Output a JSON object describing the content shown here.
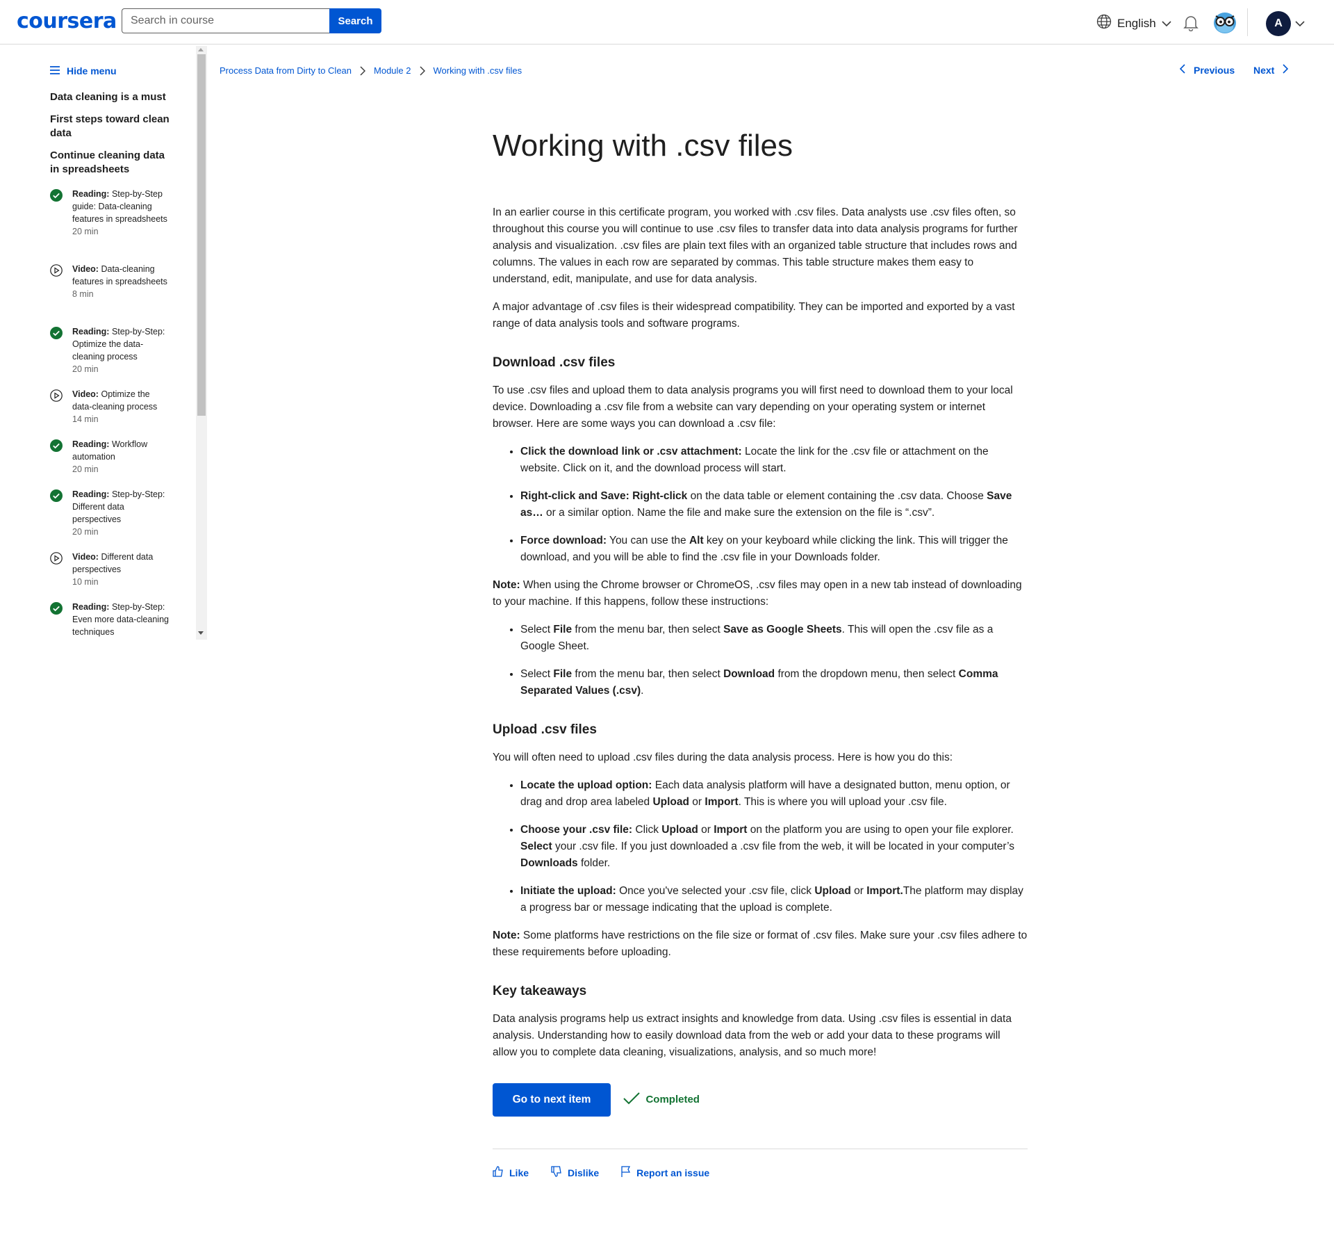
{
  "header": {
    "logo": "coursera",
    "search_placeholder": "Search in course",
    "search_button": "Search",
    "language": "English",
    "avatar_initial": "A"
  },
  "sidebar": {
    "hide_menu": "Hide menu",
    "sections": [
      "Data cleaning is a must",
      "First steps toward clean data",
      "Continue cleaning data in spreadsheets"
    ],
    "items": [
      {
        "type": "Reading:",
        "title": "Step-by-Step guide: Data-cleaning features in spreadsheets",
        "duration": "20 min",
        "status": "completed"
      },
      {
        "type": "Video:",
        "title": "Data-cleaning features in spreadsheets",
        "duration": "8 min",
        "status": "video"
      },
      {
        "type": "Reading:",
        "title": "Step-by-Step: Optimize the data-cleaning process",
        "duration": "20 min",
        "status": "completed"
      },
      {
        "type": "Video:",
        "title": "Optimize the data-cleaning process",
        "duration": "14 min",
        "status": "video"
      },
      {
        "type": "Reading:",
        "title": "Workflow automation",
        "duration": "20 min",
        "status": "completed"
      },
      {
        "type": "Reading:",
        "title": "Step-by-Step: Different data perspectives",
        "duration": "20 min",
        "status": "completed"
      },
      {
        "type": "Video:",
        "title": "Different data perspectives",
        "duration": "10 min",
        "status": "video"
      },
      {
        "type": "Reading:",
        "title": "Step-by-Step: Even more data-cleaning techniques",
        "duration": "",
        "status": "completed"
      }
    ]
  },
  "breadcrumb": [
    "Process Data from Dirty to Clean",
    "Module 2",
    "Working with .csv files"
  ],
  "nav": {
    "previous": "Previous",
    "next": "Next"
  },
  "article": {
    "title": "Working with .csv files",
    "intro_p1": "In an earlier course in this certificate program, you worked with .csv files. Data analysts use .csv files often, so throughout this course you will continue to use .csv files to transfer data into data analysis programs for further analysis and visualization. .csv files are plain text files with an organized table structure that includes rows and columns. The values in each row are separated by commas. This table structure makes them easy to understand, edit, manipulate, and use for data analysis.",
    "intro_p2": "A major advantage of .csv files is their widespread compatibility.  They can be imported and exported by a vast range of data analysis tools and software programs.",
    "download": {
      "heading": "Download .csv files",
      "intro": "To use .csv files and upload them to data analysis programs you will first need to download them to your local device. Downloading a .csv file from a website can vary depending on your operating system or internet browser. Here are some ways you can download a .csv file:",
      "b1_bold": "Click the download link or .csv attachment:",
      "b1_text": " Locate the link for the .csv file or attachment on the website. Click on it, and the download process will start.",
      "b2_bold1": "Right-click and Save: Right-click",
      "b2_text1": " on the data table or element containing the .csv data. Choose ",
      "b2_bold2": "Save as…",
      "b2_text2": " or a similar option. Name the file and make sure the extension on the file is “.csv”.",
      "b3_bold1": "Force download:",
      "b3_text1": " You can use the ",
      "b3_bold2": "Alt",
      "b3_text2": " key on your keyboard while clicking the link. This will trigger the download, and you will be able to find the .csv file in your Downloads folder.",
      "note_bold": "Note:",
      "note_text": " When using the Chrome browser or ChromeOS, .csv files may open in a new tab instead of downloading to your machine. If this happens, follow these instructions:",
      "s1_t1": "Select ",
      "s1_b1": "File",
      "s1_t2": " from the menu bar, then select ",
      "s1_b2": "Save as Google Sheets",
      "s1_t3": ". This will open the .csv file as a Google Sheet.",
      "s2_t1": "Select ",
      "s2_b1": "File",
      "s2_t2": " from the menu bar, then select ",
      "s2_b2": "Download",
      "s2_t3": " from the dropdown menu, then select ",
      "s2_b3": "Comma Separated Values (.csv)",
      "s2_t4": "."
    },
    "upload": {
      "heading": "Upload .csv files",
      "intro": "You will often need to upload .csv files during the data analysis process. Here is how you do this:",
      "u1_bold": "Locate the upload option:",
      "u1_t1": " Each data analysis platform will have a designated button, menu option, or drag and drop area labeled ",
      "u1_b2": "Upload",
      "u1_t2": " or ",
      "u1_b3": "Import",
      "u1_t3": ". This is where you will upload your .csv file.",
      "u2_bold": "Choose your .csv file:",
      "u2_t1": " Click ",
      "u2_b2": "Upload",
      "u2_t2": " or ",
      "u2_b3": "Import",
      "u2_t3": " on the platform you are using to open your file explorer. ",
      "u2_b4": "Select",
      "u2_t4": " your .csv file. If you just downloaded a .csv file from the web, it will be located in your computer’s ",
      "u2_b5": "Downloads",
      "u2_t5": " folder.",
      "u3_bold": "Initiate the upload:",
      "u3_t1": " Once you've selected your .csv file, click ",
      "u3_b2": "Upload",
      "u3_t2": " or ",
      "u3_b3": "Import.",
      "u3_t3": "The platform may display a progress bar or message indicating that the upload is complete.",
      "note_bold": "Note:",
      "note_text": " Some platforms have restrictions on the file size or format of .csv files. Make sure your .csv files adhere to these requirements before uploading."
    },
    "takeaways": {
      "heading": "Key takeaways",
      "text": "Data analysis programs help us extract insights and knowledge from data. Using .csv files is essential in data analysis. Understanding how to easily download data from the web or add your data to these programs will allow you to complete data cleaning, visualizations, analysis, and so much more!"
    },
    "next_button": "Go to next item",
    "completed_label": "Completed",
    "feedback": {
      "like": "Like",
      "dislike": "Dislike",
      "report": "Report an issue"
    }
  },
  "colors": {
    "brand": "#0056d2",
    "completed": "#137333",
    "text": "#1f1f1f"
  }
}
